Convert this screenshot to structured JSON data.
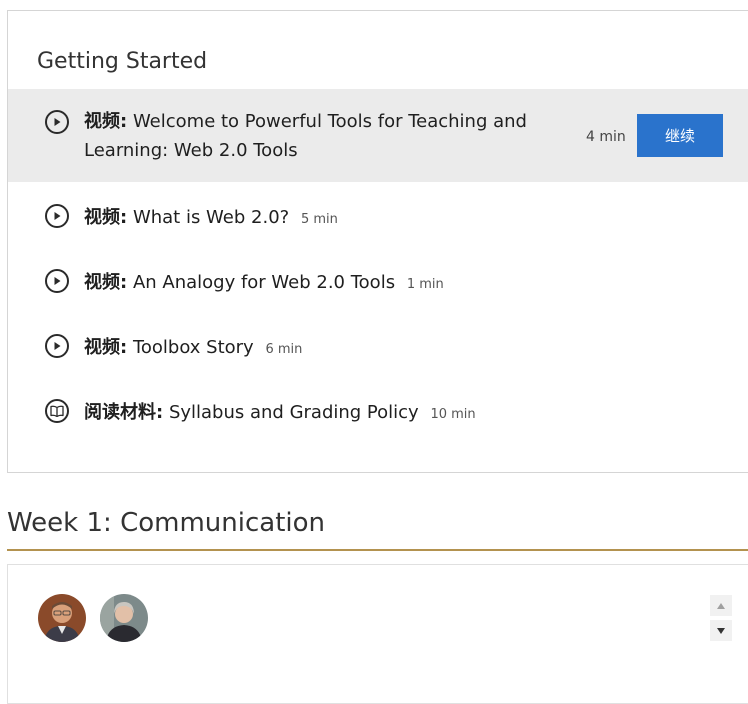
{
  "section": {
    "title": "Getting Started",
    "items": [
      {
        "type_label": "视频:",
        "title": "Welcome to Powerful Tools for Teaching and Learning: Web 2.0 Tools",
        "duration": "4 min",
        "icon": "play-icon",
        "active": true,
        "action_label": "继续"
      },
      {
        "type_label": "视频:",
        "title": "What is Web 2.0?",
        "duration": "5 min",
        "icon": "play-icon"
      },
      {
        "type_label": "视频:",
        "title": "An Analogy for Web 2.0 Tools",
        "duration": "1 min",
        "icon": "play-icon"
      },
      {
        "type_label": "视频:",
        "title": "Toolbox Story",
        "duration": "6 min",
        "icon": "play-icon"
      },
      {
        "type_label": "阅读材料:",
        "title": "Syllabus and Grading Policy",
        "duration": "10 min",
        "icon": "book-icon"
      }
    ]
  },
  "week": {
    "title": "Week 1: Communication"
  },
  "instructors": {
    "avatars": [
      "instructor-avatar-1",
      "instructor-avatar-2"
    ]
  },
  "colors": {
    "accent": "#2a73cc",
    "active_row": "#ebebeb",
    "rule": "#b3924f"
  }
}
